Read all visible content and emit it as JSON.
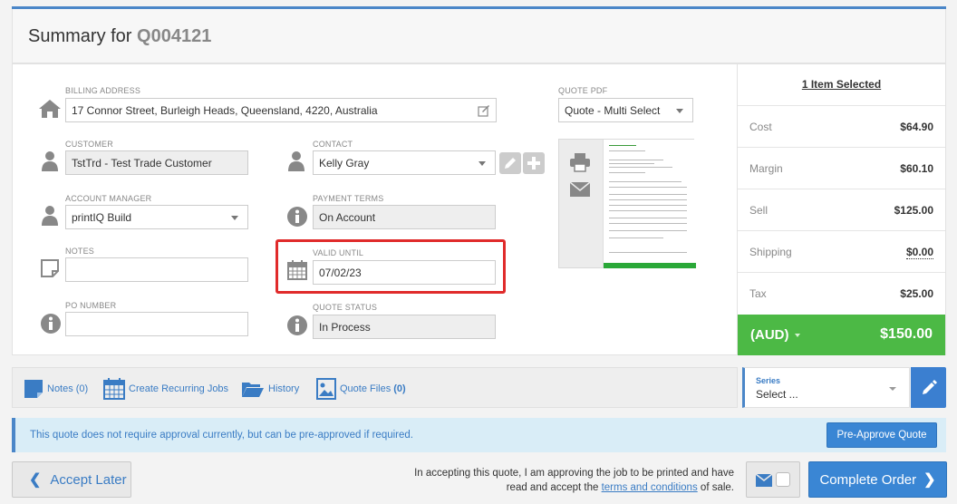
{
  "header": {
    "title_prefix": "Summary for",
    "quote_id": "Q004121"
  },
  "form": {
    "billing_address": {
      "label": "BILLING ADDRESS",
      "value": "17 Connor Street, Burleigh Heads, Queensland, 4220, Australia"
    },
    "quote_pdf": {
      "label": "QUOTE PDF",
      "value": "Quote - Multi Select"
    },
    "customer": {
      "label": "CUSTOMER",
      "value": "TstTrd - Test Trade Customer"
    },
    "contact": {
      "label": "CONTACT",
      "value": "Kelly Gray"
    },
    "account_manager": {
      "label": "ACCOUNT MANAGER",
      "value": "printIQ Build"
    },
    "payment_terms": {
      "label": "PAYMENT TERMS",
      "value": "On Account"
    },
    "notes": {
      "label": "NOTES",
      "value": ""
    },
    "valid_until": {
      "label": "VALID UNTIL",
      "value": "07/02/23"
    },
    "po_number": {
      "label": "PO NUMBER",
      "value": ""
    },
    "quote_status": {
      "label": "QUOTE STATUS",
      "value": "In Process"
    }
  },
  "summary": {
    "selected": "1 Item Selected",
    "rows": [
      {
        "label": "Cost",
        "value": "$64.90"
      },
      {
        "label": "Margin",
        "value": "$60.10"
      },
      {
        "label": "Sell",
        "value": "$125.00"
      },
      {
        "label": "Shipping",
        "value": "$0.00"
      },
      {
        "label": "Tax",
        "value": "$25.00"
      }
    ],
    "currency": "(AUD)",
    "total": "$150.00"
  },
  "actions": {
    "notes": {
      "label": "Notes",
      "count": "(0)"
    },
    "recurring": {
      "label": "Create Recurring Jobs"
    },
    "history": {
      "label": "History"
    },
    "quote_files": {
      "label": "Quote Files",
      "count": "(0)"
    }
  },
  "series": {
    "label": "Series",
    "value": "Select ..."
  },
  "notice": {
    "text": "This quote does not require approval currently, but can be pre-approved if required.",
    "button": "Pre-Approve Quote"
  },
  "footer": {
    "accept_later": "Accept Later",
    "terms_line1": "In accepting this quote, I am approving the job to be printed and have",
    "terms_line2_pre": "read and accept the",
    "terms_link": "terms and conditions",
    "terms_line2_post": "of sale.",
    "complete": "Complete Order"
  },
  "colors": {
    "accent": "#3a86d4",
    "total_green": "#4cb945",
    "highlight_red": "#e02b2b"
  },
  "icons": [
    "home-icon",
    "user-icon",
    "info-icon",
    "note-icon",
    "calendar-icon",
    "print-icon",
    "email-icon",
    "edit-icon",
    "plus-icon",
    "pencil-icon",
    "chevron-left-icon",
    "chevron-right-icon",
    "folder-icon",
    "file-image-icon"
  ]
}
